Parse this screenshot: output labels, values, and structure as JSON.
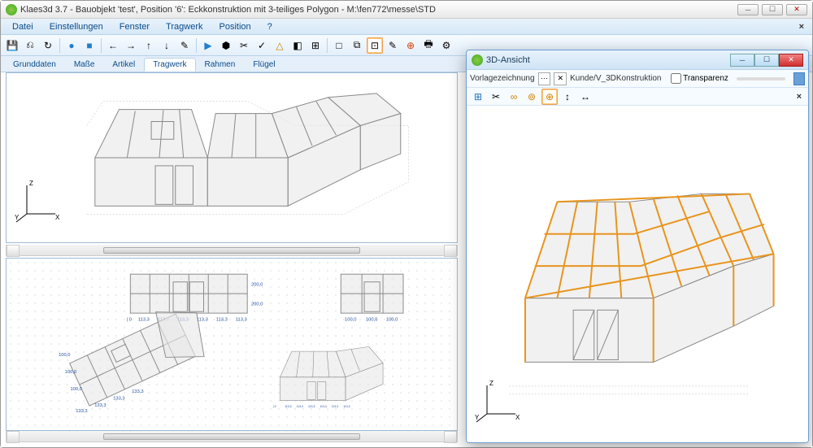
{
  "window": {
    "title": "Klaes3d 3.7 - Bauobjekt 'test', Position '6': Eckkonstruktion mit 3-teiliges Polygon  - M:\\fen772\\messe\\STD"
  },
  "menu": {
    "items": [
      "Datei",
      "Einstellungen",
      "Fenster",
      "Tragwerk",
      "Position",
      "?"
    ]
  },
  "tabs": {
    "items": [
      "Grunddaten",
      "Maße",
      "Artikel",
      "Tragwerk",
      "Rahmen",
      "Flügel"
    ],
    "active": 3
  },
  "toolbar": {
    "icons": [
      "💾",
      "⎌",
      "↻",
      "|",
      "●",
      "■",
      "|",
      "←",
      "→",
      "↑",
      "↓",
      "✎",
      "|",
      "▶",
      "⬢",
      "✂",
      "✓",
      "△",
      "◧",
      "⊞",
      "|",
      "□",
      "⧉",
      "⊡",
      "✎",
      "⊕",
      "🖶",
      "⚙"
    ],
    "active_index": 23
  },
  "float": {
    "title": "3D-Ansicht",
    "row1": {
      "label": "Vorlagezeichnung",
      "path": "Kunde/V_3DKonstruktion",
      "transparency_label": "Transparenz"
    },
    "row2_icons": [
      "⊞",
      "✂",
      "∞",
      "⊚",
      "⊕",
      "↕",
      "↔"
    ]
  },
  "axes": {
    "x": "X",
    "y": "Y",
    "z": "Z"
  },
  "dimensions": {
    "front_set": [
      "| 0",
      "113,3",
      "113,3",
      "113,3",
      "113,3",
      "113,3",
      "113,3"
    ],
    "front_v": [
      "200,0",
      "200,0"
    ],
    "side_set": [
      "100,0",
      "100,0",
      "100,0"
    ],
    "roof_set": [
      "133,3",
      "133,3",
      "133,3",
      "133,3"
    ],
    "roof_v": [
      "100,0",
      "100,0",
      "100,0"
    ],
    "iso_set": [
      "| 0",
      "113,3",
      "113,3",
      "113,3",
      "113,3",
      "113,3",
      "113,3"
    ]
  }
}
